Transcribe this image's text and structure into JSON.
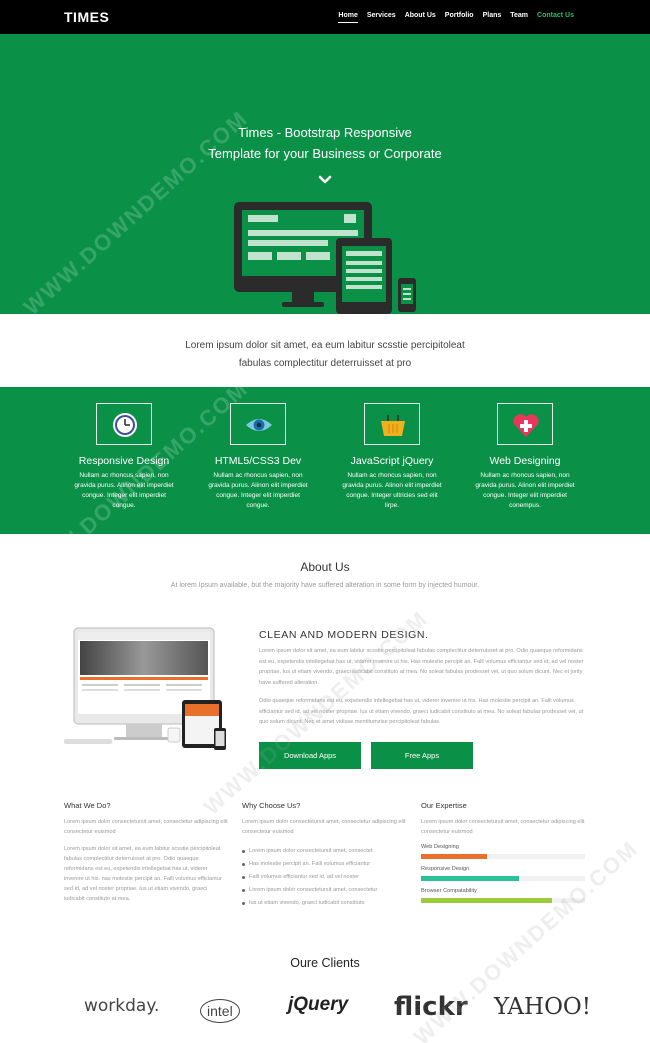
{
  "nav": {
    "brand": "TIMES",
    "items": [
      {
        "label": "Home",
        "state": "active"
      },
      {
        "label": "Services",
        "state": ""
      },
      {
        "label": "About Us",
        "state": ""
      },
      {
        "label": "Portfolio",
        "state": ""
      },
      {
        "label": "Plans",
        "state": ""
      },
      {
        "label": "Team",
        "state": ""
      },
      {
        "label": "Contact Us",
        "state": "accent"
      }
    ]
  },
  "hero": {
    "title_line1": "Times - Bootstrap Responsive",
    "title_line2": "Template for your Business or Corporate",
    "chevron_icon": "chevron-down-icon"
  },
  "intro": {
    "line1": "Lorem ipsum dolor sit amet, ea eum labitur scsstie percipitoleat",
    "line2": "fabulas complectitur deterruisset at pro"
  },
  "services": [
    {
      "icon": "clock-icon",
      "title": "Responsive Design",
      "text": "Nullam ac rhoncus sapien, non gravida purus. Alinon elit imperdiet congue. Integer elit imperdiet congue."
    },
    {
      "icon": "eye-icon",
      "title": "HTML5/CSS3 Dev",
      "text": "Nullam ac rhoncus sapien, non gravida purus. Alinon elit imperdiet congue. Integer elit imperdiet congue."
    },
    {
      "icon": "basket-icon",
      "title": "JavaScript jQuery",
      "text": "Nullam ac rhoncus sapien, non gravida purus. Alinon elit imperdiet congue. Integer ultricies sed elit lirpe."
    },
    {
      "icon": "heart-plus-icon",
      "title": "Web Designing",
      "text": "Nullam ac rhoncus sapien, non gravida purus. Alinon elit imperdiet congue. Integer elit imperdiet conempus."
    }
  ],
  "about": {
    "title": "About Us",
    "subtitle": "At lorem Ipsum available, but the majority have suffered alteration in some form by injected humour.",
    "heading": "CLEAN AND MODERN DESIGN.",
    "para1": "Lorem ipsum dolor sit amet, ea eum labitur scsstie percipitoleat fabulas complectitur deterruisset at pro. Odio quaeque reformidans est eu, expetendis intellegebat has ut, viderer invenire ut his. Has molestie percipit an. Falli volumus efficiantur sed id, ad vel noster propriae. Ius ut etiam vivendo, graeci iudicabit constituto at mea. No soleat fabulas prodesset vel, ut quo solum dicunt. Nec et jority have suffered alteration.",
    "para2": "Odio quaeque reformidans est eu, expetendis intellegebat has ut, viderer invenire ut his. Has molestie percipit an. Falli volumus efficiantur sed id, ad vel noster propriae. Ius ut etiam vivendo, graeci iudicabit constituto at mea. No soleat fabulas prodesset vel, ut quo solum dicunt. Nec et amet vidisse mentitumzise percipitoleat fabulas.",
    "download_btn": "Download Apps",
    "free_btn": "Free Apps"
  },
  "columns": {
    "what": {
      "title": "What We Do?",
      "p1": "Lorem ipsum dolor consectetursit amet, consectetur adipiscing elit consectetur euismod",
      "p2": "Lorem ipsum dolor sit amet, ea eum labitur scsstie percipitoleat fabulas complectitur deterruisset at pro. Odio quaeque reformidans est eu, expetendis intellegebat has ut, viderer invenire ut his. nas molestie percipit an. Falli volumus efficiantur sed id, ad vel noster propriae. Ius ut etiam vivendo, graeci iudicabit constituto at mea."
    },
    "why": {
      "title": "Why Choose Us?",
      "p1": "Lorem ipsum dolor consectetursit amet, consectetur adipiscing elit consectetur euismod",
      "items": [
        "Lorem ipsum dolor consectetursit amet, consectet",
        "Has molestie percipit an. Falli volumus efficiantur",
        "Falli volumus efficiantur sed id, ad vel noster",
        "Lorem ipsum dolor consectetursit amet, consectetur",
        "Ius ut etiam vivendo, graeci iudicabit constituto"
      ]
    },
    "expertise": {
      "title": "Our Expertise",
      "p1": "Lorem ipsum dolor consectetursit amet, consectetur adipiscing elit consectetur euismod",
      "skills": [
        {
          "label": "Web Designing",
          "value": 0.4,
          "color": "#e8702a"
        },
        {
          "label": "Responsive Design",
          "value": 0.6,
          "color": "#2bbf9a"
        },
        {
          "label": "Browser Compatability",
          "value": 0.8,
          "color": "#9ccb3b"
        }
      ]
    }
  },
  "clients": {
    "title": "Oure Clients",
    "logos": [
      "workday.",
      "intel",
      "jQuery",
      "flickr",
      "YAHOO!"
    ]
  },
  "watermark": "WWW.DOWNDEMO.COM"
}
